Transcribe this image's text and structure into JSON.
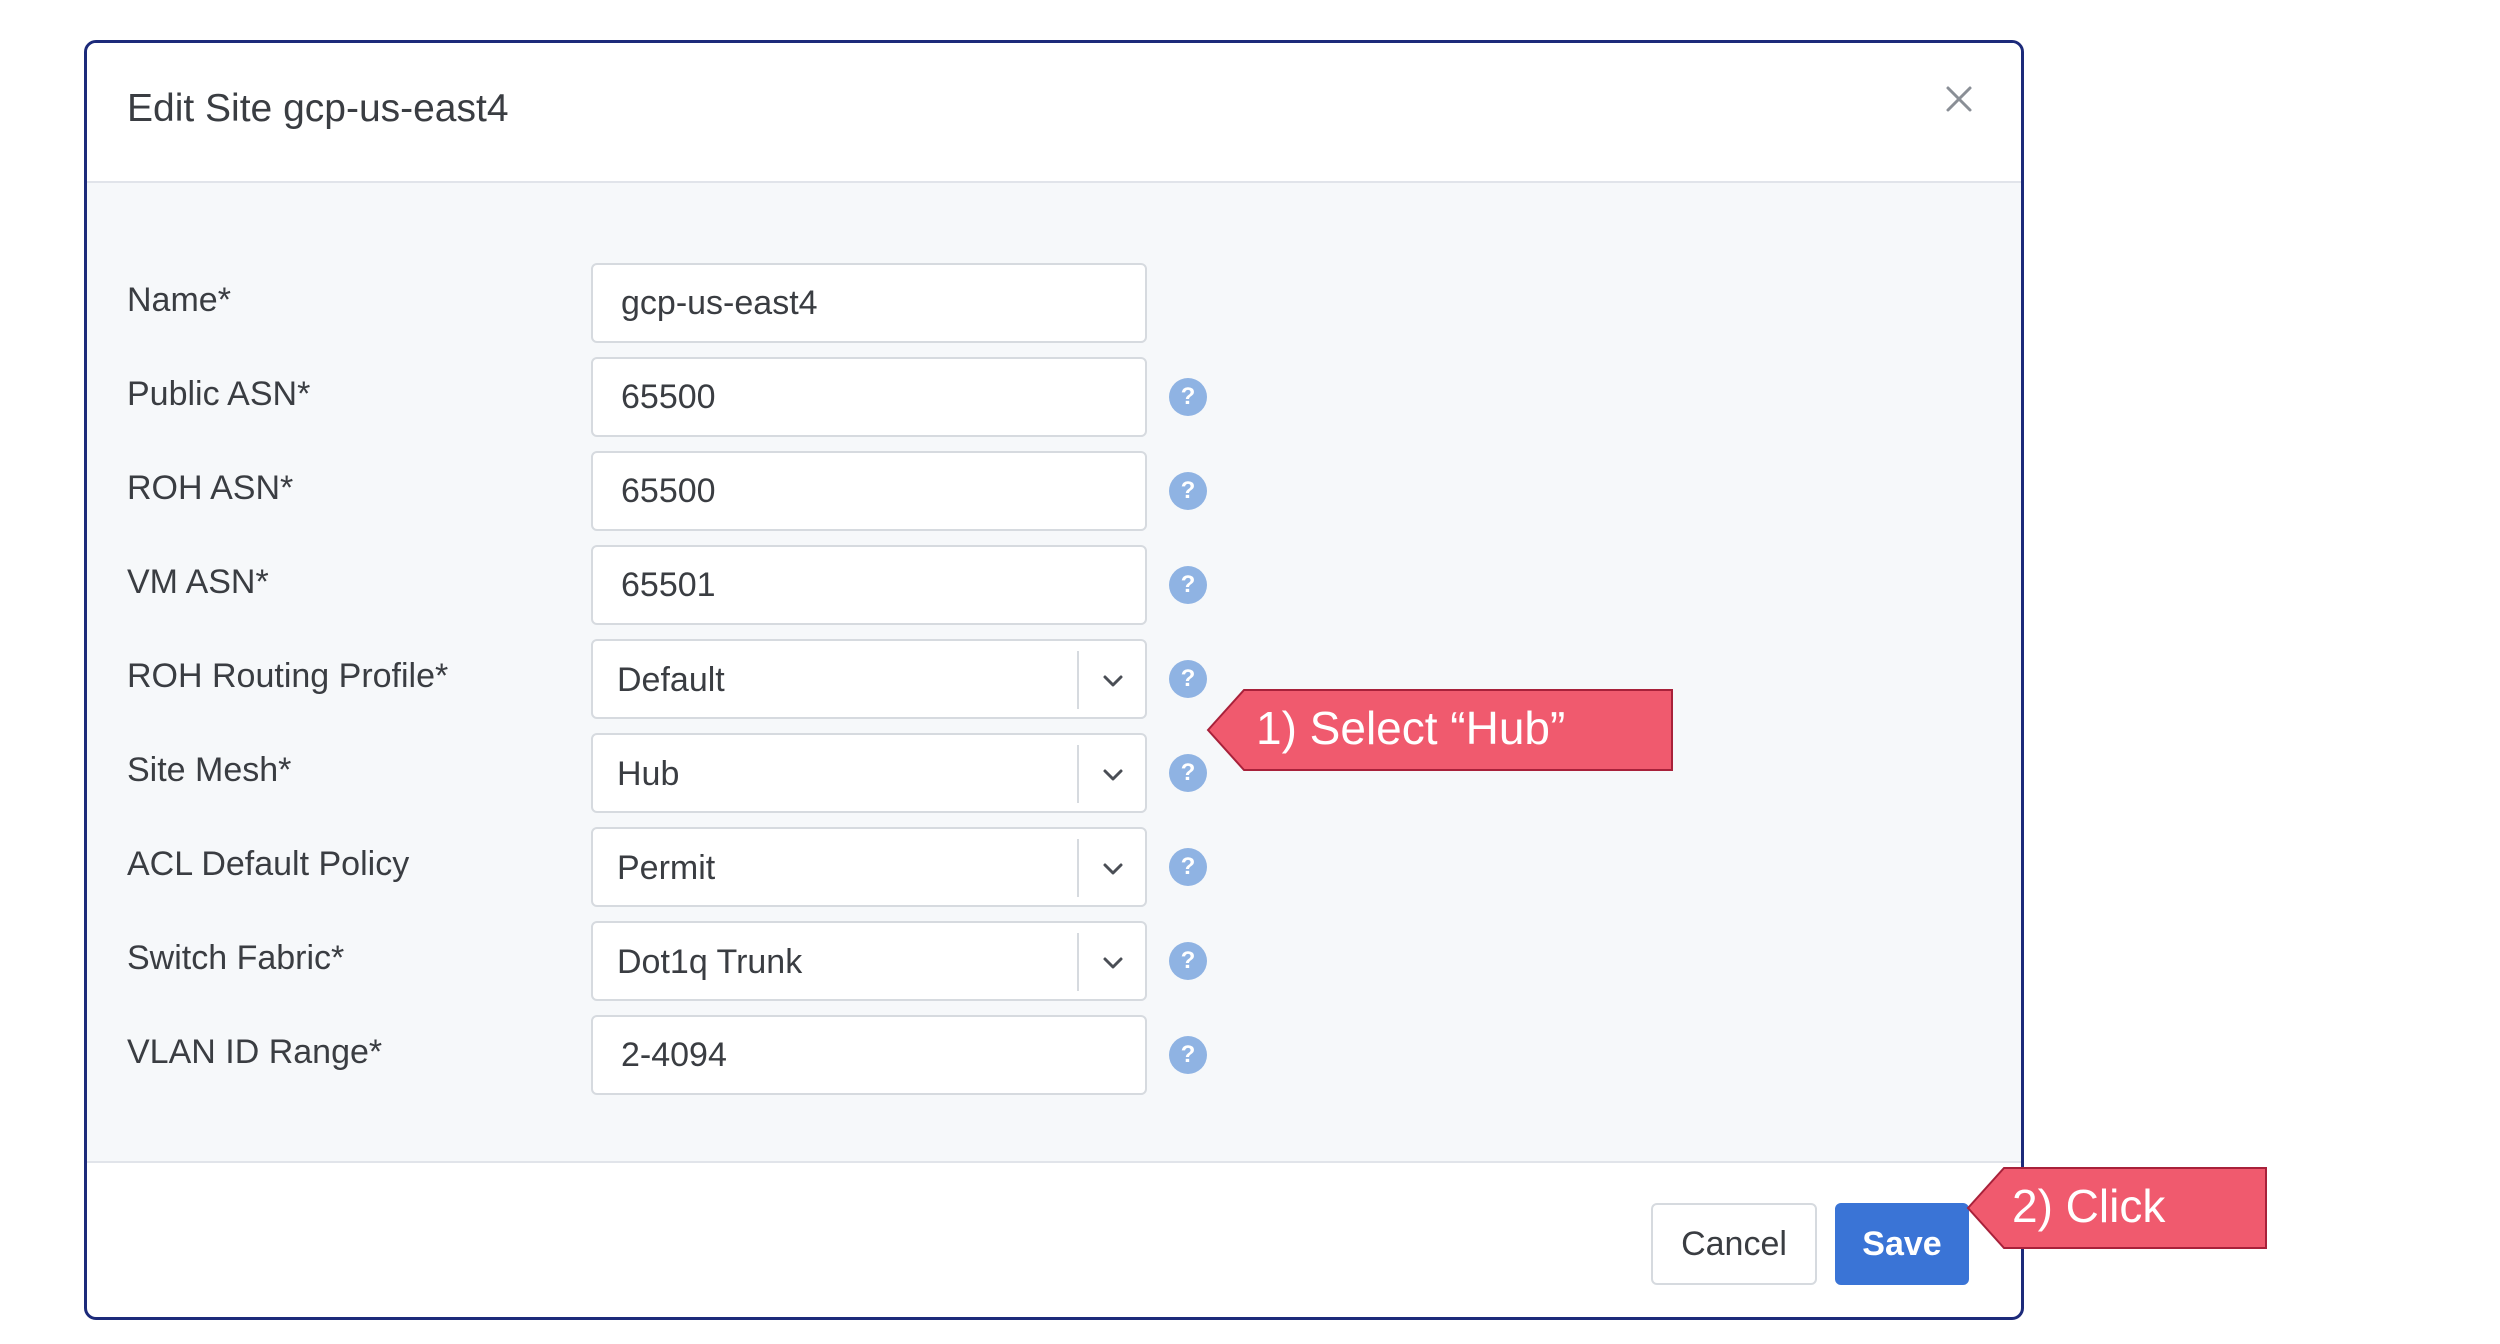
{
  "modal": {
    "title": "Edit Site gcp-us-east4",
    "fields": [
      {
        "label": "Name*",
        "value": "gcp-us-east4"
      },
      {
        "label": "Public ASN*",
        "value": "65500",
        "help": "?"
      },
      {
        "label": "ROH ASN*",
        "value": "65500",
        "help": "?"
      },
      {
        "label": "VM ASN*",
        "value": "65501",
        "help": "?"
      },
      {
        "label": "ROH Routing Profile*",
        "value": "Default",
        "help": "?"
      },
      {
        "label": "Site Mesh*",
        "value": "Hub",
        "help": "?"
      },
      {
        "label": "ACL Default Policy",
        "value": "Permit",
        "help": "?"
      },
      {
        "label": "Switch Fabric*",
        "value": "Dot1q Trunk",
        "help": "?"
      },
      {
        "label": "VLAN ID Range*",
        "value": "2-4094",
        "help": "?"
      }
    ],
    "footer": {
      "cancel_label": "Cancel",
      "save_label": "Save"
    }
  },
  "annotations": {
    "step1": "1) Select “Hub”",
    "step2": "2) Click"
  },
  "colors": {
    "modal_border": "#1c2a7a",
    "primary_button": "#3a74d6",
    "help_icon": "#8fb3e3",
    "callout": "#f05a6e"
  },
  "icons": {
    "close": "close-icon",
    "help": "help-circle-icon",
    "dropdown": "chevron-down-icon"
  }
}
